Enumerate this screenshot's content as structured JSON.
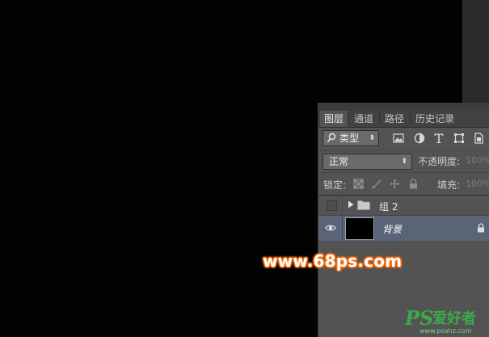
{
  "tabs": [
    {
      "label": "图层",
      "active": true
    },
    {
      "label": "通道",
      "active": false
    },
    {
      "label": "路径",
      "active": false
    },
    {
      "label": "历史记录",
      "active": false
    }
  ],
  "filter": {
    "kind_label": "类型",
    "arrows": "⬍",
    "icons": [
      "image-filter-icon",
      "adjustment-filter-icon",
      "type-filter-icon",
      "shape-filter-icon",
      "smart-object-filter-icon"
    ]
  },
  "blend": {
    "mode": "正常",
    "arrows": "⬍",
    "opacity_label": "不透明度:",
    "opacity_value": "100%"
  },
  "lock": {
    "label": "锁定:",
    "fill_label": "填充:",
    "fill_value": "100%"
  },
  "layers": {
    "group_name": "组 2",
    "background_name": "背景"
  },
  "watermark": {
    "url": "www.68ps.com",
    "logo_ps": "PS",
    "logo_cn": "爱好者",
    "logo_url": "www.psahz.com"
  },
  "colors": {
    "panel_bg": "#535353",
    "selected_layer": "#596477",
    "accent_orange": "#ff7a1a",
    "logo_green": "#3fa84a"
  }
}
